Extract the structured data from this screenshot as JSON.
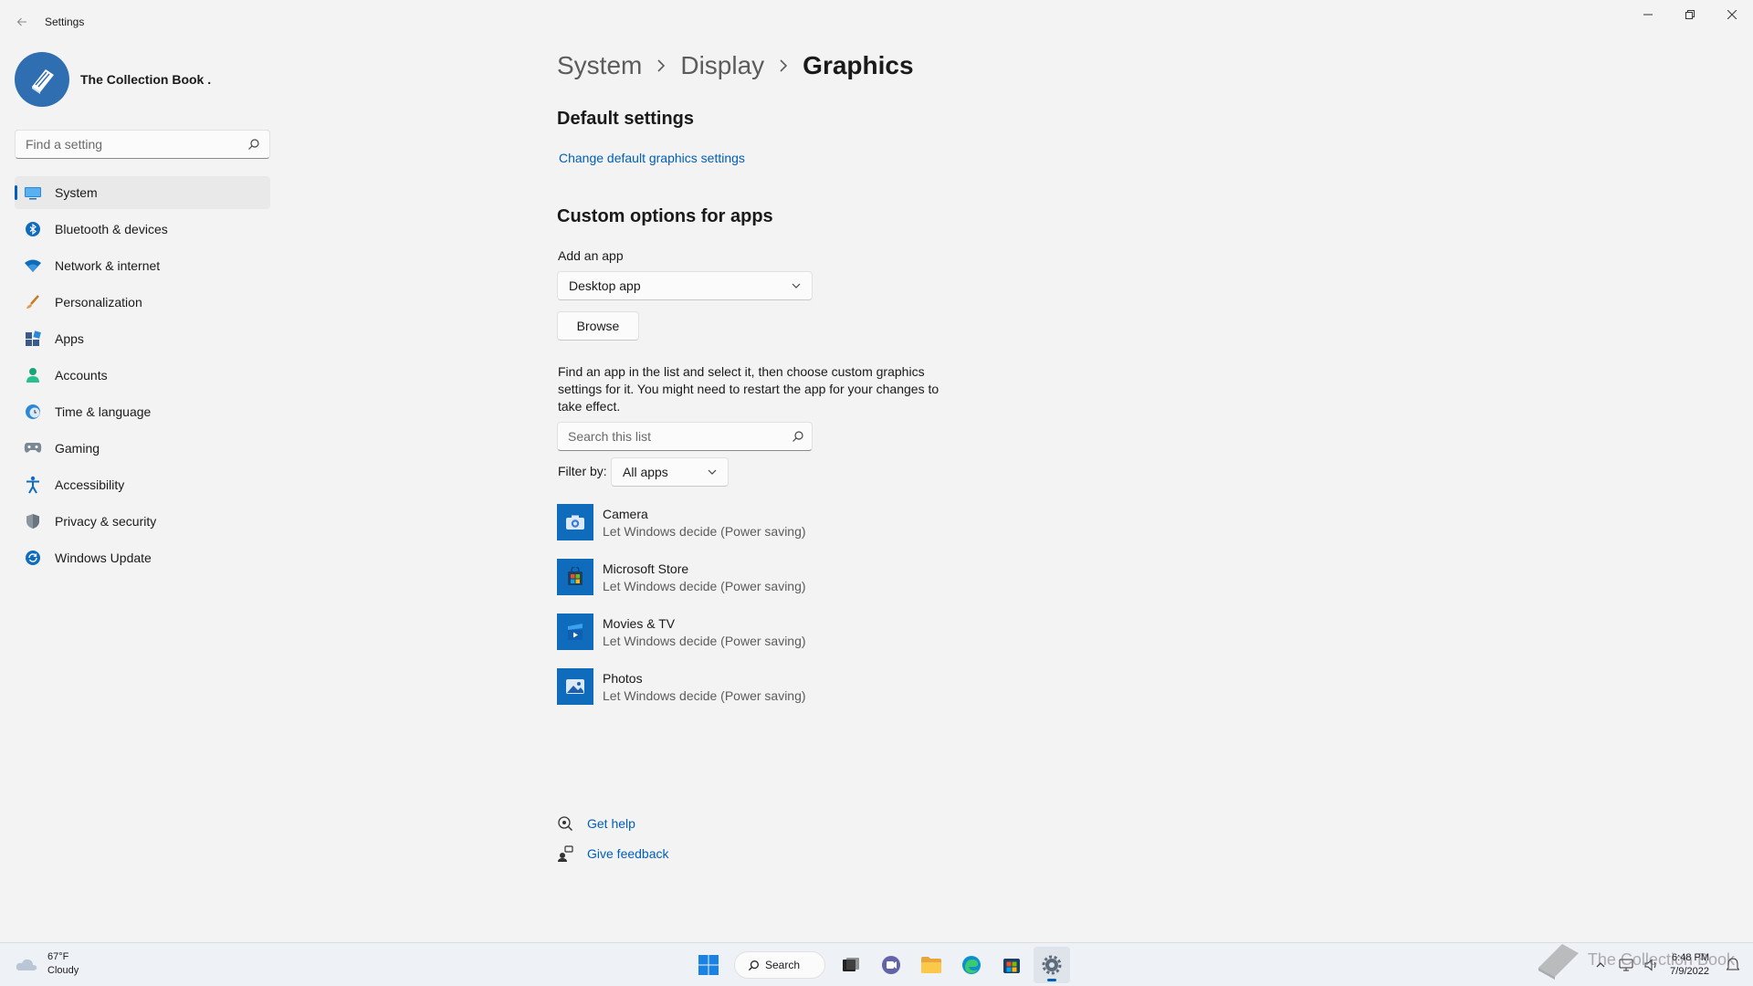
{
  "window": {
    "app_title": "Settings",
    "controls": [
      "minimize",
      "restore",
      "close"
    ]
  },
  "profile": {
    "name": "The Collection Book ."
  },
  "sidebar": {
    "search_placeholder": "Find a setting",
    "items": [
      {
        "label": "System",
        "icon": "monitor-icon",
        "active": true
      },
      {
        "label": "Bluetooth & devices",
        "icon": "bluetooth-icon"
      },
      {
        "label": "Network & internet",
        "icon": "wifi-icon"
      },
      {
        "label": "Personalization",
        "icon": "brush-icon"
      },
      {
        "label": "Apps",
        "icon": "apps-icon"
      },
      {
        "label": "Accounts",
        "icon": "person-icon"
      },
      {
        "label": "Time & language",
        "icon": "clock-globe-icon"
      },
      {
        "label": "Gaming",
        "icon": "gamepad-icon"
      },
      {
        "label": "Accessibility",
        "icon": "accessibility-icon"
      },
      {
        "label": "Privacy & security",
        "icon": "shield-icon"
      },
      {
        "label": "Windows Update",
        "icon": "update-icon"
      }
    ]
  },
  "breadcrumb": [
    "System",
    "Display",
    "Graphics"
  ],
  "main": {
    "default_settings_title": "Default settings",
    "change_default_link": "Change default graphics settings",
    "custom_options_title": "Custom options for apps",
    "add_app_label": "Add an app",
    "app_type_selected": "Desktop app",
    "browse_label": "Browse",
    "description": "Find an app in the list and select it, then choose custom graphics settings for it. You might need to restart the app for your changes to take effect.",
    "list_search_placeholder": "Search this list",
    "filter_label": "Filter by:",
    "filter_selected": "All apps",
    "apps": [
      {
        "name": "Camera",
        "status": "Let Windows decide (Power saving)",
        "icon": "camera-icon"
      },
      {
        "name": "Microsoft Store",
        "status": "Let Windows decide (Power saving)",
        "icon": "store-icon"
      },
      {
        "name": "Movies & TV",
        "status": "Let Windows decide (Power saving)",
        "icon": "movies-icon"
      },
      {
        "name": "Photos",
        "status": "Let Windows decide (Power saving)",
        "icon": "photos-icon"
      }
    ],
    "get_help": "Get help",
    "give_feedback": "Give feedback"
  },
  "taskbar": {
    "weather_temp": "67°F",
    "weather_desc": "Cloudy",
    "search_label": "Search",
    "time": "6:48 PM",
    "date": "7/9/2022",
    "watermark": "The Collection Book"
  },
  "colors": {
    "accent": "#005fb8",
    "background": "#f3f3f3",
    "app_tile": "#0f6cbd"
  }
}
